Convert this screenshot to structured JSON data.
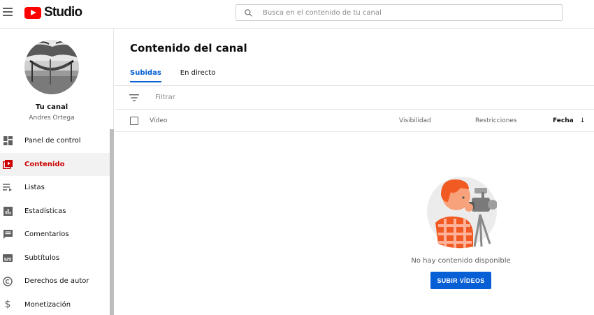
{
  "header": {
    "logo_text": "Studio",
    "search_placeholder": "Busca en el contenido de tu canal"
  },
  "sidebar": {
    "channel_name": "Tu canal",
    "channel_user": "Andres Ortega",
    "items": [
      {
        "label": "Panel de control",
        "icon": "dashboard-icon"
      },
      {
        "label": "Contenido",
        "icon": "content-icon",
        "active": true
      },
      {
        "label": "Listas",
        "icon": "playlist-icon"
      },
      {
        "label": "Estadísticas",
        "icon": "analytics-icon"
      },
      {
        "label": "Comentarios",
        "icon": "comments-icon"
      },
      {
        "label": "Subtítulos",
        "icon": "subtitles-icon"
      },
      {
        "label": "Derechos de autor",
        "icon": "copyright-icon"
      },
      {
        "label": "Monetización",
        "icon": "dollar-icon"
      }
    ]
  },
  "main": {
    "title": "Contenido del canal",
    "tabs": [
      {
        "label": "Subidas",
        "active": true
      },
      {
        "label": "En directo"
      }
    ],
    "filter_label": "Filtrar",
    "columns": {
      "video": "Vídeo",
      "visibility": "Visibilidad",
      "restrictions": "Restricciones",
      "date": "Fecha"
    },
    "empty_state": {
      "message": "No hay contenido disponible",
      "button": "SUBIR VÍDEOS"
    }
  },
  "colors": {
    "accent": "#065fd4",
    "brand_red": "#ff0000",
    "active_red": "#cc0000"
  }
}
